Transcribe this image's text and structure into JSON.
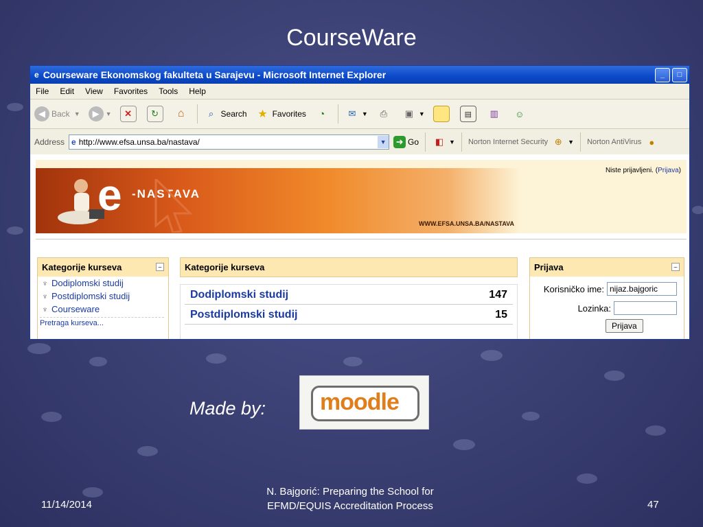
{
  "slide": {
    "title": "CourseWare",
    "made_by": "Made by:",
    "logo_text": "moodle",
    "footer_date": "11/14/2014",
    "footer_text_line1": "N. Bajgorić: Preparing the School for",
    "footer_text_line2": "EFMD/EQUIS Accreditation Process",
    "page_number": "47"
  },
  "browser": {
    "window_title": "Courseware Ekonomskog fakulteta u Sarajevu - Microsoft Internet Explorer",
    "menu": [
      "File",
      "Edit",
      "View",
      "Favorites",
      "Tools",
      "Help"
    ],
    "toolbar": {
      "back": "Back",
      "search": "Search",
      "favorites": "Favorites"
    },
    "address_label": "Address",
    "address_url": "http://www.efsa.unsa.ba/nastava/",
    "go": "Go",
    "norton_security": "Norton Internet Security",
    "norton_antivirus": "Norton AntiVirus"
  },
  "page": {
    "banner_e": "e",
    "banner_nastava": "-NASTAVA",
    "banner_url": "WWW.EFSA.UNSA.BA/NASTAVA",
    "login_status_prefix": "Niste prijavljeni. (",
    "login_status_link": "Prijava",
    "login_status_suffix": ")",
    "left_block": {
      "title": "Kategorije kurseva",
      "items": [
        "Dodiplomski studij",
        "Postdiplomski studij",
        "Courseware"
      ],
      "search_link": "Pretraga kurseva..."
    },
    "center_block": {
      "title": "Kategorije kurseva",
      "rows": [
        {
          "name": "Dodiplomski studij",
          "count": "147"
        },
        {
          "name": "Postdiplomski studij",
          "count": "15"
        }
      ]
    },
    "login_block": {
      "title": "Prijava",
      "username_label": "Korisničko ime:",
      "username_value": "nijaz.bajgoric",
      "password_label": "Lozinka:",
      "password_value": "",
      "submit": "Prijava"
    }
  }
}
